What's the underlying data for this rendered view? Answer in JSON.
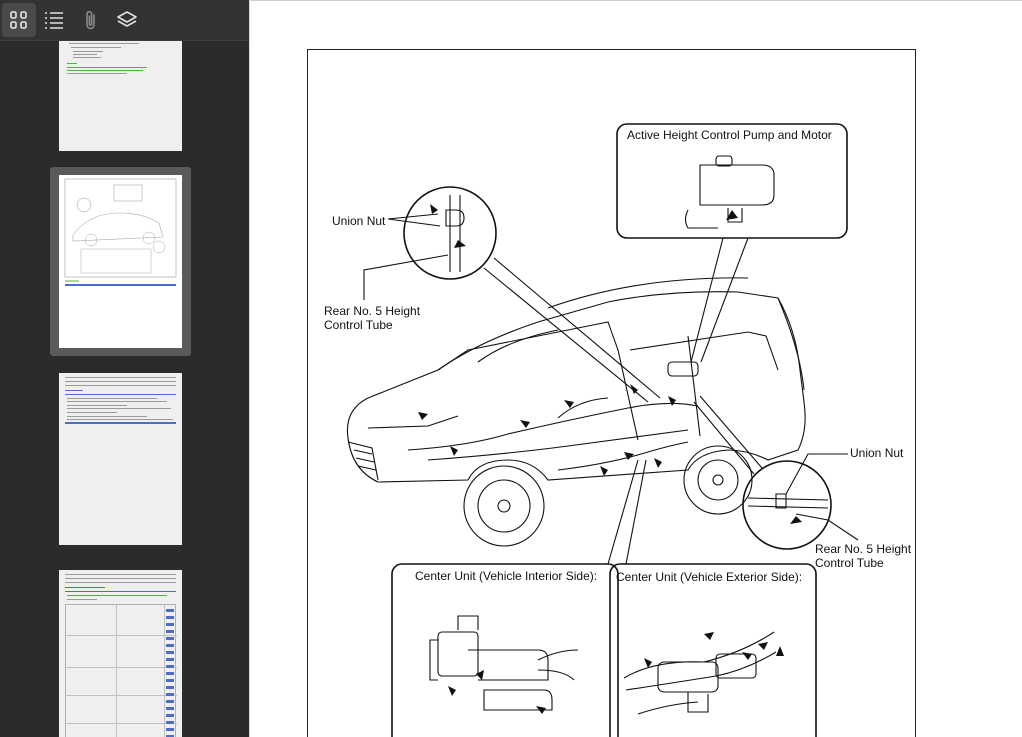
{
  "toolbar": {
    "buttons": [
      {
        "name": "thumbnails-icon",
        "active": true
      },
      {
        "name": "outline-icon",
        "active": false
      },
      {
        "name": "attachments-icon",
        "active": false
      },
      {
        "name": "layers-icon",
        "active": false
      }
    ]
  },
  "diagram": {
    "label_union_nut_top": "Union Nut",
    "label_tube_left_line1": "Rear No. 5 Height",
    "label_tube_left_line2": "Control Tube",
    "label_pump": "Active Height Control Pump and Motor",
    "label_union_nut_right": "Union Nut",
    "label_tube_right_line1": "Rear No. 5 Height",
    "label_tube_right_line2": "Control Tube",
    "label_center_interior": "Center Unit (Vehicle Interior Side):",
    "label_center_exterior": "Center Unit (Vehicle Exterior Side):"
  },
  "colors": {
    "sidebar_bg": "#2b2b2b",
    "toolbar_bg": "#333333",
    "selection_bg": "#5a5a5a",
    "thumb_bg": "#efefef",
    "accent_blue": "#4a6fc9",
    "accent_green": "#5aa94a"
  }
}
